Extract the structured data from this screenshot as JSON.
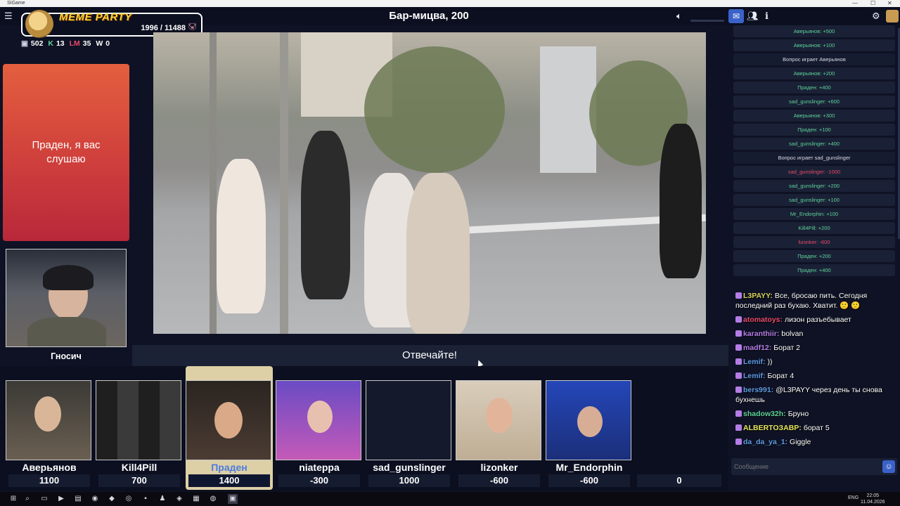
{
  "window": {
    "app_name": "SIGame",
    "controls": [
      "—",
      "☐",
      "✕"
    ]
  },
  "topbar": {
    "game_title": "Бар-мицва, 200"
  },
  "overlay": {
    "title": "MEME PARTY",
    "counter": "1996 / 11488"
  },
  "stats": [
    {
      "icon": "chat-icon",
      "value": "502",
      "color": "#ffffff"
    },
    {
      "icon": "k-icon",
      "value": "13",
      "color": "#5fd39a"
    },
    {
      "icon": "lm-icon",
      "value": "35",
      "color": "#ea4a6a"
    },
    {
      "icon": "w-icon",
      "value": "0",
      "color": "#ffffff"
    }
  ],
  "question": {
    "text": "Праден, я вас слушаю"
  },
  "host": {
    "name": "Гносич"
  },
  "answer_bar": {
    "text": "Отвечайте!"
  },
  "players": [
    {
      "name": "Аверьянов",
      "score": "1100",
      "active": false
    },
    {
      "name": "Kill4Pill",
      "score": "700",
      "active": false
    },
    {
      "name": "Праден",
      "score": "1400",
      "active": true
    },
    {
      "name": "niateppa",
      "score": "-300",
      "active": false
    },
    {
      "name": "sad_gunslinger",
      "score": "1000",
      "active": false
    },
    {
      "name": "lizonker",
      "score": "-600",
      "active": false
    },
    {
      "name": "Mr_Endorphin",
      "score": "-600",
      "active": false
    }
  ],
  "extra_score": "0",
  "log": [
    {
      "text": "Аверьянов: +500",
      "kind": "pos"
    },
    {
      "text": "Аверьянов: +100",
      "kind": "pos"
    },
    {
      "text": "Вопрос играет Аверьянов",
      "kind": "neutral"
    },
    {
      "text": "Аверьянов: +200",
      "kind": "pos"
    },
    {
      "text": "Праден: +400",
      "kind": "pos"
    },
    {
      "text": "sad_gunslinger: +600",
      "kind": "pos"
    },
    {
      "text": "Аверьянов: +300",
      "kind": "pos"
    },
    {
      "text": "Праден: +100",
      "kind": "pos"
    },
    {
      "text": "sad_gunslinger: +400",
      "kind": "pos"
    },
    {
      "text": "Вопрос играет sad_gunslinger",
      "kind": "neutral"
    },
    {
      "text": "sad_gunslinger: -1000",
      "kind": "neg"
    },
    {
      "text": "sad_gunslinger: +200",
      "kind": "pos"
    },
    {
      "text": "sad_gunslinger: +100",
      "kind": "pos"
    },
    {
      "text": "Mr_Endorphin: +100",
      "kind": "pos"
    },
    {
      "text": "Kill4Pill: +200",
      "kind": "pos"
    },
    {
      "text": "lizonker: -600",
      "kind": "neg"
    },
    {
      "text": "Праден: +200",
      "kind": "pos"
    },
    {
      "text": "Праден: +400",
      "kind": "pos"
    }
  ],
  "chat": [
    {
      "user": "L3PAYY:",
      "color": "#d8d25a",
      "text": "Все, бросаю пить. Сегодня последний раз бухаю. Хватит. 🙂 🙂"
    },
    {
      "user": "atomatoys:",
      "color": "#ea4a6a",
      "text": "лизон разъебывает"
    },
    {
      "user": "karanthiir:",
      "color": "#b57ce6",
      "text": "bolvan"
    },
    {
      "user": "madf12:",
      "color": "#b57ce6",
      "text": "Борат 2"
    },
    {
      "user": "Lemif:",
      "color": "#5f9ce6",
      "text": "))"
    },
    {
      "user": "Lemif:",
      "color": "#5f9ce6",
      "text": "Борат 4"
    },
    {
      "user": "bers991:",
      "color": "#5f9ce6",
      "text": "@L3PAYY через день ты снова бухнешь"
    },
    {
      "user": "shadow32h:",
      "color": "#5fd39a",
      "text": "Бруно"
    },
    {
      "user": "ALBERTOЗABP:",
      "color": "#e6e65a",
      "text": "борат 5"
    },
    {
      "user": "da_da_ya_1:",
      "color": "#5f9ce6",
      "text": "Giggle"
    }
  ],
  "message_box": {
    "placeholder": "Сообщение"
  },
  "tray": {
    "lang": "ENG",
    "time": "22:05",
    "date": "11.04.2026"
  }
}
